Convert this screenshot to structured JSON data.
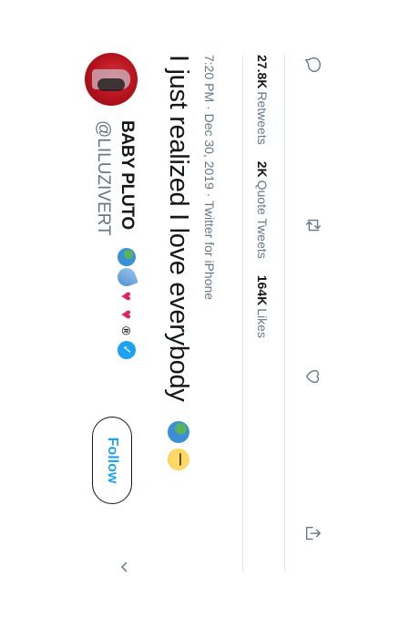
{
  "author": {
    "display_name": "BABY PLUTO",
    "handle": "@LILUZIVERT",
    "verified": true,
    "name_emojis": [
      "globe-icon",
      "comet-icon",
      "heart-icon",
      "heart-icon",
      "registered-mark"
    ]
  },
  "follow_button": {
    "label": "Follow"
  },
  "tweet": {
    "text": "I just realized I love everybody",
    "text_emojis": [
      "globe-icon",
      "smirk-face-icon"
    ],
    "time": "7:20 PM",
    "date": "Dec 30, 2019",
    "source": "Twitter for iPhone"
  },
  "meta_sep": "·",
  "registered_mark": "®",
  "stats": {
    "retweets_count": "27.8K",
    "retweets_label": "Retweets",
    "quotes_count": "2K",
    "quotes_label": "Quote Tweets",
    "likes_count": "164K",
    "likes_label": "Likes"
  },
  "actions": [
    "reply-icon",
    "retweet-icon",
    "like-icon",
    "share-icon"
  ],
  "colors": {
    "accent": "#1da1f2",
    "text": "#14171a",
    "muted": "#657786",
    "divider": "#e1e8ed",
    "heart": "#e0245e"
  }
}
